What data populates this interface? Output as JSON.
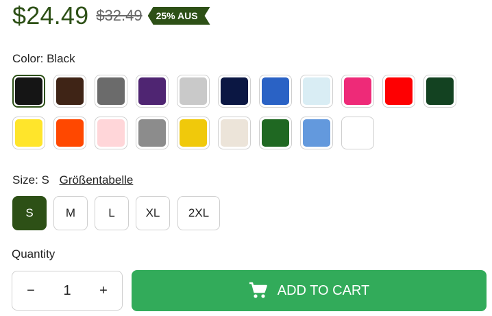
{
  "price": {
    "current": "$24.49",
    "original": "$32.49",
    "badge": "25% AUS"
  },
  "color": {
    "label": "Color: Black",
    "swatches": [
      {
        "name": "Black",
        "hex": "#151515",
        "selected": true
      },
      {
        "name": "Brown",
        "hex": "#3f2416"
      },
      {
        "name": "Charcoal",
        "hex": "#6b6b6b"
      },
      {
        "name": "Purple",
        "hex": "#4f2572"
      },
      {
        "name": "Light Grey",
        "hex": "#c9c9c9"
      },
      {
        "name": "Navy",
        "hex": "#0b1743"
      },
      {
        "name": "Royal Blue",
        "hex": "#2a62c5"
      },
      {
        "name": "Light Blue",
        "hex": "#d9edf4"
      },
      {
        "name": "Pink",
        "hex": "#ee2a78"
      },
      {
        "name": "Red",
        "hex": "#fe0002"
      },
      {
        "name": "Forest Green",
        "hex": "#134221"
      },
      {
        "name": "Yellow",
        "hex": "#ffe52b"
      },
      {
        "name": "Orange",
        "hex": "#ff4800"
      },
      {
        "name": "Light Pink",
        "hex": "#ffd6d9"
      },
      {
        "name": "Grey",
        "hex": "#8c8c8c"
      },
      {
        "name": "Gold",
        "hex": "#f0c90b"
      },
      {
        "name": "Cream",
        "hex": "#ece4d9"
      },
      {
        "name": "Green",
        "hex": "#1f6822"
      },
      {
        "name": "Sky Blue",
        "hex": "#6399dd"
      },
      {
        "name": "White",
        "hex": "#ffffff"
      }
    ]
  },
  "size": {
    "label": "Size: S",
    "chart_link": "Größentabelle",
    "options": [
      {
        "label": "S",
        "selected": true
      },
      {
        "label": "M"
      },
      {
        "label": "L"
      },
      {
        "label": "XL"
      },
      {
        "label": "2XL"
      }
    ]
  },
  "quantity": {
    "label": "Quantity",
    "value": "1",
    "minus": "−",
    "plus": "+"
  },
  "add_to_cart": {
    "label": "ADD TO CART",
    "icon": "cart-icon"
  },
  "colors": {
    "brand_green": "#2d5016",
    "cart_green": "#32ab5a"
  }
}
